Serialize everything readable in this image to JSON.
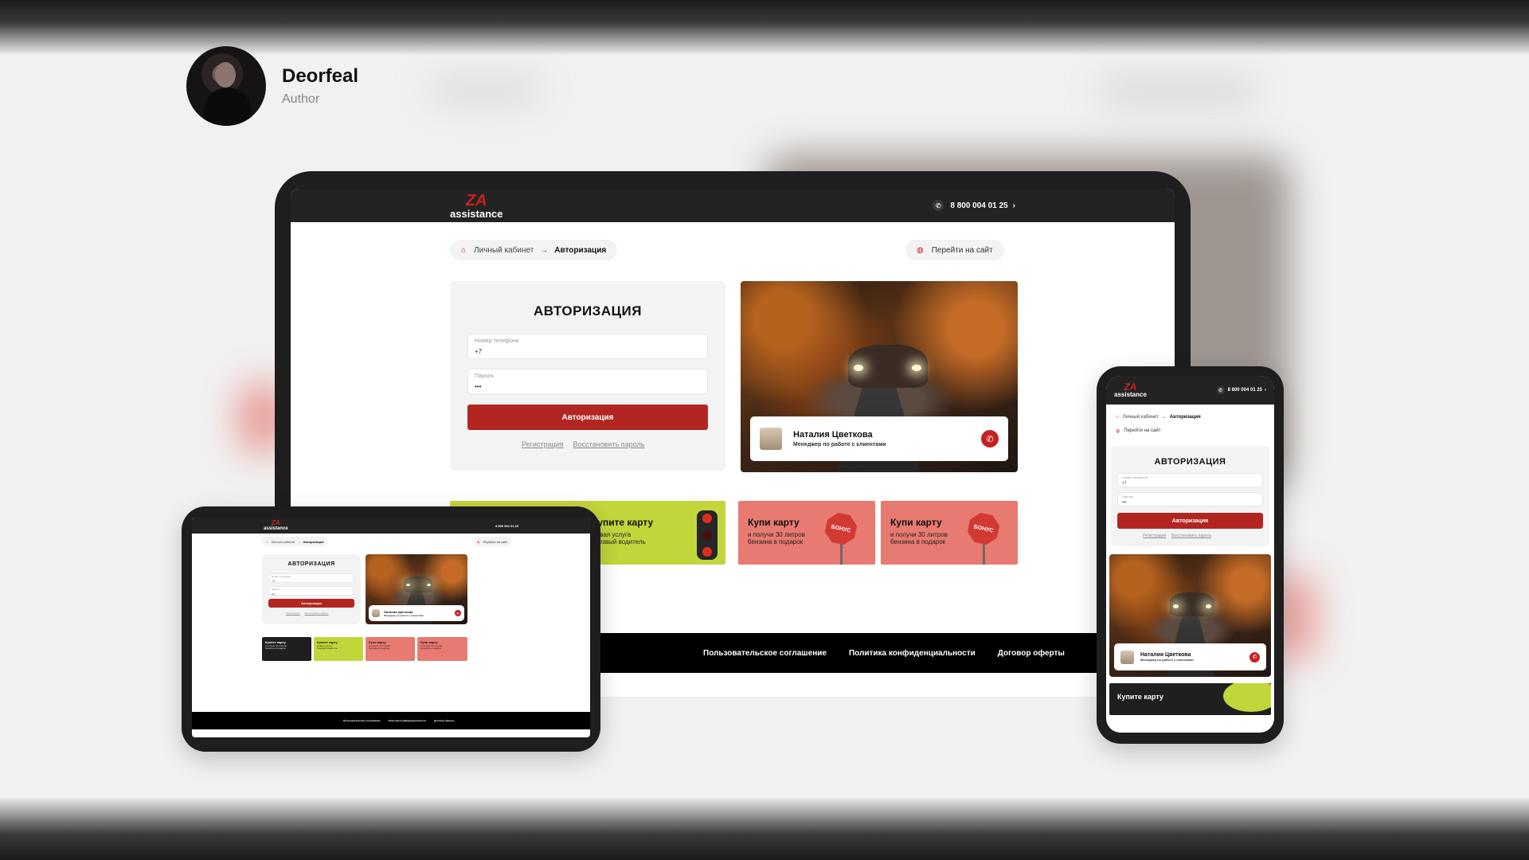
{
  "author": {
    "name": "Deorfeal",
    "role": "Author"
  },
  "site": {
    "logo_mark": "ZA",
    "logo_word": "assistance",
    "phone": "8 800 004 01 25",
    "chevron": "›",
    "breadcrumb": {
      "parent": "Личный кабинет",
      "arrow": "→",
      "current": "Авторизация"
    },
    "goto_site": "Перейти на сайт",
    "auth": {
      "title": "АВТОРИЗАЦИЯ",
      "phone_label": "Номер телефона",
      "phone_value": "+7",
      "password_label": "Пароль",
      "password_value": "•••",
      "submit": "Авторизация",
      "register": "Регистрация",
      "restore": "Восстановить пароль"
    },
    "manager": {
      "name": "Наталия Цветкова",
      "role": "Менеджер по работе с клиентами"
    },
    "promos": [
      {
        "title": "Купите карту",
        "subtitle": "Новая услуга\nТрезвый водитель",
        "color": "#c2d63c",
        "icon": "traffic-light-icon"
      },
      {
        "title": "Купи карту",
        "subtitle": "и получи 30 литров\nбензина в подарок",
        "color": "#e87a72",
        "icon": "bonus-stop-sign-icon",
        "sign": "БОНУС"
      },
      {
        "title": "Купи карту",
        "subtitle": "и получи 30 литров\nбензина в подарок",
        "color": "#e87a72",
        "icon": "bonus-stop-sign-icon",
        "sign": "БОНУС"
      }
    ],
    "tablet_first_promo": {
      "title": "Купите карту",
      "subtitle": "и получи 30 литров\nбензина в подарок",
      "color": "#1f1f1f"
    },
    "phone_peek_promo": "Купите карту",
    "footer": [
      "Пользовательское соглашение",
      "Политика конфиденциальности",
      "Договор оферты"
    ]
  },
  "colors": {
    "brand_red": "#c4221f",
    "button_red": "#b32521",
    "lime": "#c2d63c",
    "salmon": "#e87a72"
  }
}
